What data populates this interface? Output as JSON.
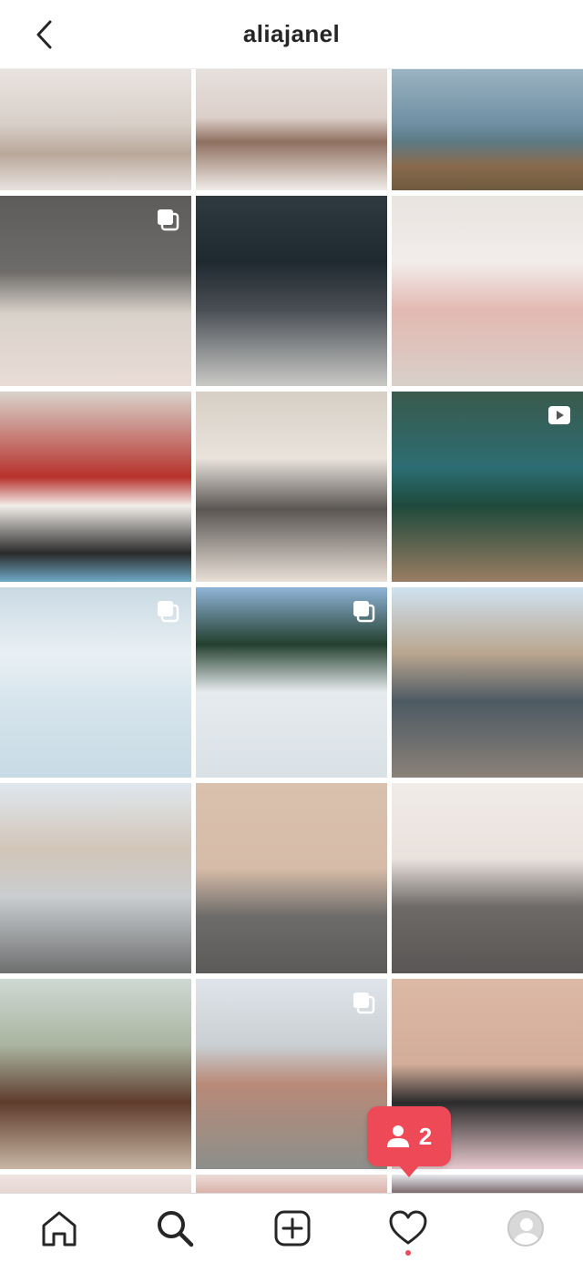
{
  "header": {
    "title": "aliajanel",
    "back_icon": "chevron-left-icon"
  },
  "grid": {
    "tiles": [
      {
        "badge": null
      },
      {
        "badge": null
      },
      {
        "badge": null
      },
      {
        "badge": "carousel-icon"
      },
      {
        "badge": null
      },
      {
        "badge": null
      },
      {
        "badge": null
      },
      {
        "badge": null
      },
      {
        "badge": "video-icon"
      },
      {
        "badge": "carousel-icon"
      },
      {
        "badge": "carousel-icon"
      },
      {
        "badge": null
      },
      {
        "badge": null
      },
      {
        "badge": null
      },
      {
        "badge": null
      },
      {
        "badge": null
      },
      {
        "badge": "carousel-icon"
      },
      {
        "badge": null
      },
      {
        "badge": null
      },
      {
        "badge": null
      },
      {
        "badge": null
      }
    ]
  },
  "notification": {
    "count": "2",
    "icon": "person-icon",
    "color": "#ed4956"
  },
  "bottom_nav": {
    "items": [
      {
        "icon": "home-icon"
      },
      {
        "icon": "search-icon"
      },
      {
        "icon": "add-post-icon"
      },
      {
        "icon": "heart-icon"
      },
      {
        "icon": "profile-avatar-icon"
      }
    ]
  }
}
